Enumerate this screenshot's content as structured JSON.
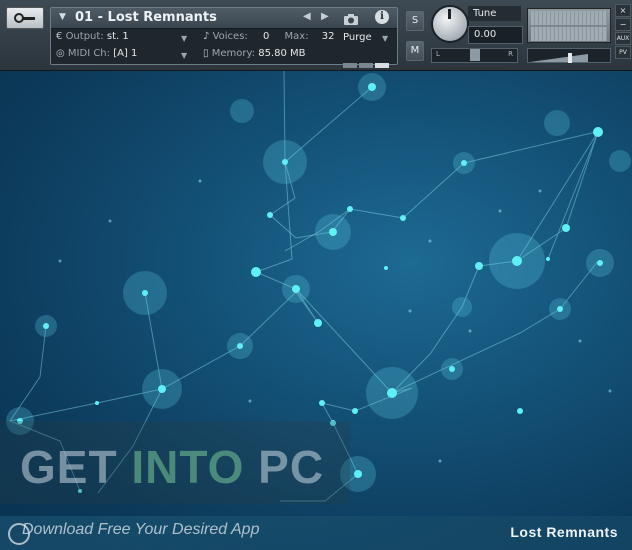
{
  "header": {
    "instrument_name": "01 - Lost Remnants",
    "output_label": "Output:",
    "output_value": "st. 1",
    "voices_label": "Voices:",
    "voices_value": "0",
    "max_label": "Max:",
    "max_value": "32",
    "midi_label": "MIDI Ch:",
    "midi_value": "[A]  1",
    "memory_label": "Memory:",
    "memory_value": "85.80 MB",
    "purge_label": "Purge",
    "solo_label": "S",
    "mute_label": "M",
    "tune_label": "Tune",
    "tune_value": "0.00",
    "pan_left": "L",
    "pan_right": "R",
    "close_label": "×",
    "minus_label": "−",
    "aux_label": "AUX",
    "pv_label": "PV"
  },
  "artwork": {
    "watermark_get": "GET ",
    "watermark_into": "INTO",
    "watermark_pc": " PC",
    "tagline": "Download Free Your Desired App",
    "product_name": "Lost Remnants"
  },
  "colors": {
    "accent_cyan": "#39e6f0",
    "background_blue": "#134f75",
    "header_gray": "#3e4a53"
  }
}
